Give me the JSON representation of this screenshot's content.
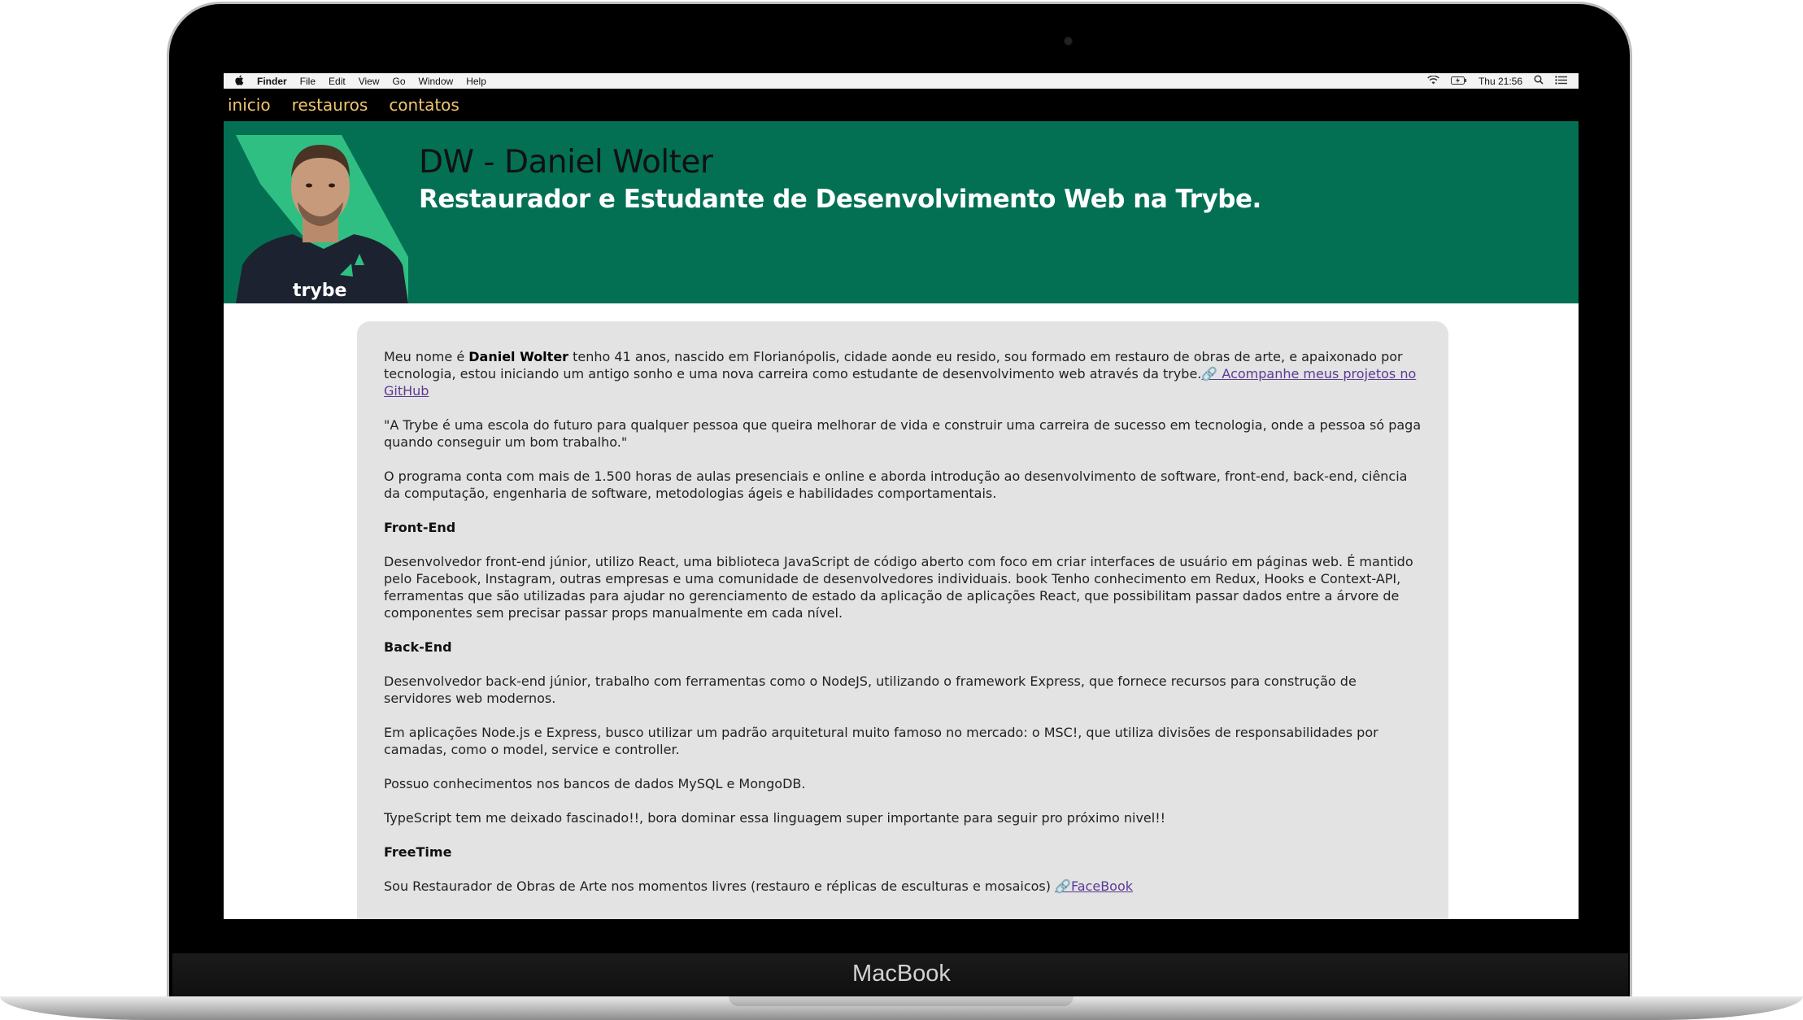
{
  "device": {
    "label": "MacBook"
  },
  "menubar": {
    "app": "Finder",
    "items": [
      "File",
      "Edit",
      "View",
      "Go",
      "Window",
      "Help"
    ],
    "clock": "Thu 21:56"
  },
  "nav": {
    "links": [
      "inicio",
      "restauros",
      "contatos"
    ]
  },
  "hero": {
    "title": "DW - Daniel Wolter",
    "subtitle": "Restaurador e Estudante de Desenvolvimento Web na Trybe.",
    "avatar_shirt_text": "trybe"
  },
  "content": {
    "intro": {
      "prefix": "Meu nome é ",
      "name": "Daniel Wolter",
      "text": " tenho 41 anos, nascido em Florianópolis, cidade aonde eu resido, sou formado em restauro de obras de arte, e apaixonado por tecnologia, estou iniciando um antigo sonho e uma nova carreira como estudante de desenvolvimento web através da trybe.",
      "link": "🔗 Acompanhe meus projetos no GitHub"
    },
    "quote": "\"A Trybe é uma escola do futuro para qualquer pessoa que queira melhorar de vida e construir uma carreira de sucesso em tecnologia, onde a pessoa só paga quando conseguir um bom trabalho.\"",
    "program": "O programa conta com mais de 1.500 horas de aulas presenciais e online e aborda introdução ao desenvolvimento de software, front-end, back-end, ciência da computação, engenharia de software, metodologias ágeis e habilidades comportamentais.",
    "frontend_heading": "Front-End",
    "frontend_text": "Desenvolvedor front-end júnior, utilizo React, uma biblioteca JavaScript de código aberto com foco em criar interfaces de usuário em páginas web. É mantido pelo Facebook, Instagram, outras empresas e uma comunidade de desenvolvedores individuais. book Tenho conhecimento em Redux, Hooks e Context-API, ferramentas que são utilizadas para ajudar no gerenciamento de estado da aplicação de aplicações React, que possibilitam passar dados entre a árvore de componentes sem precisar passar props manualmente em cada nível.",
    "backend_heading": "Back-End",
    "backend_text": "Desenvolvedor back-end júnior, trabalho com ferramentas como o NodeJS, utilizando o framework Express, que fornece recursos para construção de servidores web modernos.",
    "msc_text": "Em aplicações Node.js e Express, busco utilizar um padrão arquitetural muito famoso no mercado: o MSC!, que utiliza divisões de responsabilidades por camadas, como o model, service e controller.",
    "db_text": "Possuo conhecimentos nos bancos de dados MySQL e MongoDB.",
    "ts_text": "TypeScript tem me deixado fascinado!!, bora dominar essa linguagem super importante para seguir pro próximo nivel!!",
    "freetime_heading": "FreeTime",
    "freetime_text": "Sou Restaurador de Obras de Arte nos momentos livres (restauro e réplicas de esculturas e mosaicos) ",
    "facebook_link": "🔗FaceBook"
  },
  "colors": {
    "hero_bg": "#037054",
    "nav_link": "#f0c66e",
    "card_bg": "#e3e3e3",
    "link": "#5b3b93"
  }
}
